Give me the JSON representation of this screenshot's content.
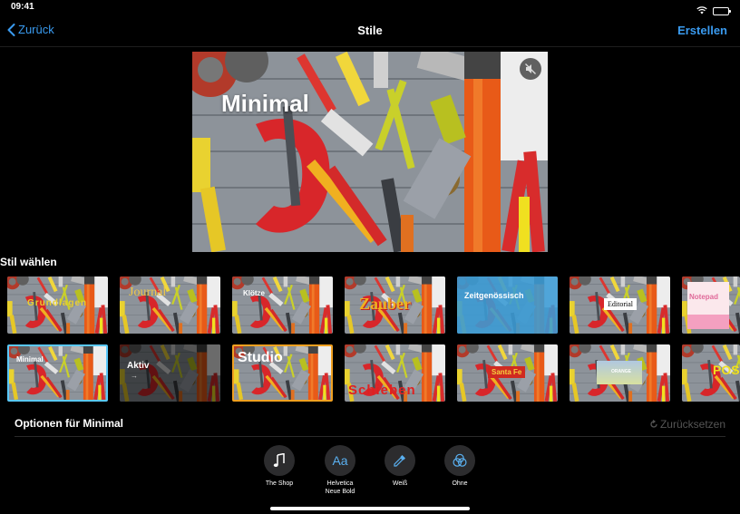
{
  "status_bar": {
    "time": "09:41",
    "wifi_icon": "wifi-icon",
    "battery_icon": "battery-icon"
  },
  "nav": {
    "back_label": "Zurück",
    "title": "Stile",
    "create_label": "Erstellen"
  },
  "preview": {
    "title": "Minimal",
    "mute_icon": "speaker-muted-icon"
  },
  "section": {
    "label": "Stil wählen"
  },
  "styles_row1": [
    {
      "label": "Grundlagen"
    },
    {
      "label": "Journal"
    },
    {
      "label": "Klötze"
    },
    {
      "label": "Zauber"
    },
    {
      "label": "Zeitgenössisch"
    },
    {
      "label": "Editorial"
    },
    {
      "label": "Notepad"
    }
  ],
  "styles_row2": [
    {
      "label": "Minimal"
    },
    {
      "label": "Aktiv",
      "arrow": "→"
    },
    {
      "label": "Studio"
    },
    {
      "label": "Schieben"
    },
    {
      "label": "Santa Fe"
    },
    {
      "label": "ORANGE"
    },
    {
      "label": "POSTER"
    }
  ],
  "options": {
    "label": "Optionen für Minimal",
    "reset_label": "Zurücksetzen",
    "items": [
      {
        "label": "The Shop",
        "icon": "music-note-icon"
      },
      {
        "label": "Helvetica\nNeue Bold",
        "glyph": "Aa",
        "icon": "font-icon"
      },
      {
        "label": "Weiß",
        "icon": "eyedropper-icon"
      },
      {
        "label": "Ohne",
        "icon": "filter-icon"
      }
    ]
  },
  "colors": {
    "accent": "#3a9bf0",
    "selected": "#5ac8fa",
    "background": "#000000"
  }
}
